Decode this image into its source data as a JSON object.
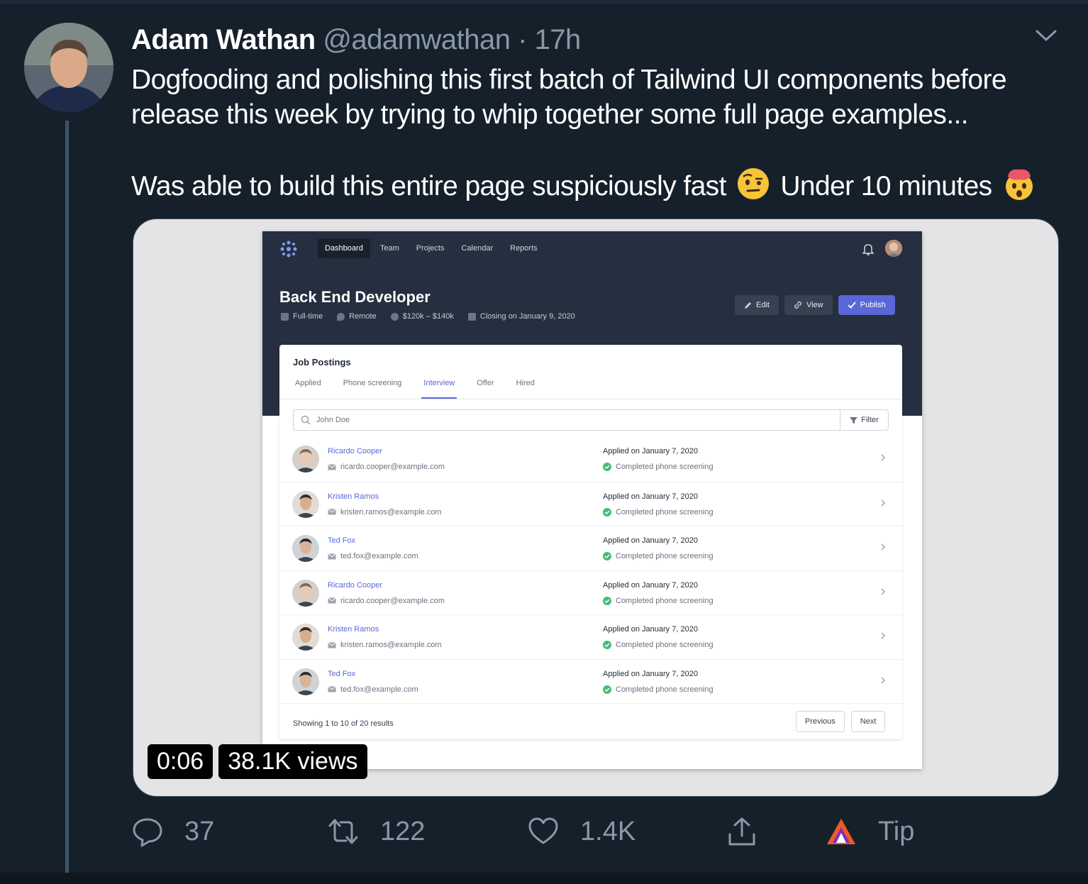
{
  "tweet": {
    "name": "Adam Wathan",
    "handle": "@adamwathan",
    "separator": "·",
    "time": "17h",
    "text_line1": "Dogfooding and polishing this first batch of Tailwind UI components before",
    "text_line2": "release this week by trying to whip together some full page examples...",
    "text_line3_a": "Was able to build this entire page suspiciously fast",
    "text_line3_b": "Under 10 minutes",
    "emoji_1": "face-with-raised-eyebrow",
    "emoji_2": "exploding-head"
  },
  "media": {
    "duration": "0:06",
    "views": "38.1K views"
  },
  "app": {
    "nav": [
      "Dashboard",
      "Team",
      "Projects",
      "Calendar",
      "Reports"
    ],
    "job_title": "Back End Developer",
    "meta": {
      "type": "Full-time",
      "location": "Remote",
      "salary": "$120k – $140k",
      "closing": "Closing on January 9, 2020"
    },
    "actions": {
      "edit": "Edit",
      "view": "View",
      "publish": "Publish"
    },
    "card_title": "Job Postings",
    "tabs": [
      "Applied",
      "Phone screening",
      "Interview",
      "Offer",
      "Hired"
    ],
    "search_placeholder": "John Doe",
    "filter_label": "Filter",
    "rows": [
      {
        "name": "Ricardo Cooper",
        "email": "ricardo.cooper@example.com",
        "date": "Applied on January 7, 2020",
        "status": "Completed phone screening"
      },
      {
        "name": "Kristen Ramos",
        "email": "kristen.ramos@example.com",
        "date": "Applied on January 7, 2020",
        "status": "Completed phone screening"
      },
      {
        "name": "Ted Fox",
        "email": "ted.fox@example.com",
        "date": "Applied on January 7, 2020",
        "status": "Completed phone screening"
      },
      {
        "name": "Ricardo Cooper",
        "email": "ricardo.cooper@example.com",
        "date": "Applied on January 7, 2020",
        "status": "Completed phone screening"
      },
      {
        "name": "Kristen Ramos",
        "email": "kristen.ramos@example.com",
        "date": "Applied on January 7, 2020",
        "status": "Completed phone screening"
      },
      {
        "name": "Ted Fox",
        "email": "ted.fox@example.com",
        "date": "Applied on January 7, 2020",
        "status": "Completed phone screening"
      }
    ],
    "results_text": "Showing 1 to 10 of 20 results",
    "prev_label": "Previous",
    "next_label": "Next",
    "accent_color": "#5a67d8"
  },
  "tweet_actions": {
    "replies": "37",
    "retweets": "122",
    "likes": "1.4K",
    "tip": "Tip"
  }
}
